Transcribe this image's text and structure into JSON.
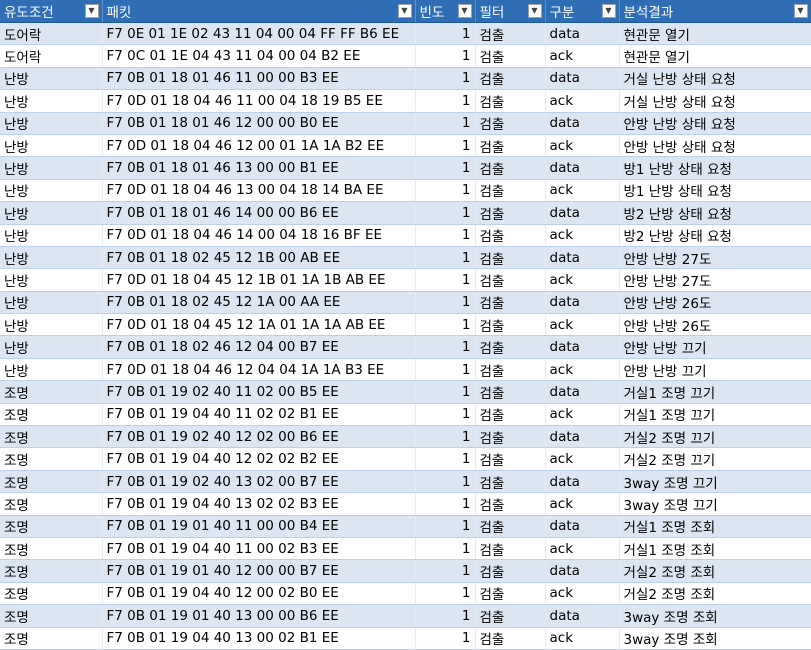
{
  "header": {
    "columns": [
      {
        "label": "유도조건",
        "filter_icon": "filter-active-icon"
      },
      {
        "label": "패킷",
        "filter_icon": "dropdown-arrow-icon"
      },
      {
        "label": "빈도",
        "filter_icon": "dropdown-arrow-icon"
      },
      {
        "label": "필터",
        "filter_icon": "dropdown-arrow-icon"
      },
      {
        "label": "구분",
        "filter_icon": "dropdown-arrow-icon"
      },
      {
        "label": "분석결과",
        "filter_icon": "dropdown-arrow-icon"
      }
    ]
  },
  "rows": [
    {
      "cond": "도어락",
      "packet": "F7 0E 01 1E 02 43 11 04 00 04 FF FF B6 EE",
      "freq": "1",
      "filter": "검출",
      "type": "data",
      "result": "현관문 열기"
    },
    {
      "cond": "도어락",
      "packet": "F7 0C 01 1E 04 43 11 04 00 04 B2 EE",
      "freq": "1",
      "filter": "검출",
      "type": "ack",
      "result": "현관문 열기"
    },
    {
      "cond": "난방",
      "packet": "F7 0B 01 18 01 46 11 00 00 B3 EE",
      "freq": "1",
      "filter": "검출",
      "type": "data",
      "result": "거실 난방 상태 요청"
    },
    {
      "cond": "난방",
      "packet": "F7 0D 01 18 04 46 11 00 04 18 19 B5 EE",
      "freq": "1",
      "filter": "검출",
      "type": "ack",
      "result": "거실 난방 상태 요청"
    },
    {
      "cond": "난방",
      "packet": "F7 0B 01 18 01 46 12 00 00 B0 EE",
      "freq": "1",
      "filter": "검출",
      "type": "data",
      "result": "안방 난방 상태 요청"
    },
    {
      "cond": "난방",
      "packet": "F7 0D 01 18 04 46 12 00 01 1A 1A B2 EE",
      "freq": "1",
      "filter": "검출",
      "type": "ack",
      "result": "안방 난방 상태 요청"
    },
    {
      "cond": "난방",
      "packet": "F7 0B 01 18 01 46 13 00 00 B1 EE",
      "freq": "1",
      "filter": "검출",
      "type": "data",
      "result": "방1 난방 상태 요청"
    },
    {
      "cond": "난방",
      "packet": "F7 0D 01 18 04 46 13 00 04 18 14 BA EE",
      "freq": "1",
      "filter": "검출",
      "type": "ack",
      "result": "방1 난방 상태 요청"
    },
    {
      "cond": "난방",
      "packet": "F7 0B 01 18 01 46 14 00 00 B6 EE",
      "freq": "1",
      "filter": "검출",
      "type": "data",
      "result": "방2 난방 상태 요청"
    },
    {
      "cond": "난방",
      "packet": "F7 0D 01 18 04 46 14 00 04 18 16 BF EE",
      "freq": "1",
      "filter": "검출",
      "type": "ack",
      "result": "방2 난방 상태 요청"
    },
    {
      "cond": "난방",
      "packet": "F7 0B 01 18 02 45 12 1B 00 AB EE",
      "freq": "1",
      "filter": "검출",
      "type": "data",
      "result": "안방 난방 27도"
    },
    {
      "cond": "난방",
      "packet": "F7 0D 01 18 04 45 12 1B 01 1A 1B AB EE",
      "freq": "1",
      "filter": "검출",
      "type": "ack",
      "result": "안방 난방 27도"
    },
    {
      "cond": "난방",
      "packet": "F7 0B 01 18 02 45 12 1A 00 AA EE",
      "freq": "1",
      "filter": "검출",
      "type": "data",
      "result": "안방 난방 26도"
    },
    {
      "cond": "난방",
      "packet": "F7 0D 01 18 04 45 12 1A 01 1A 1A AB EE",
      "freq": "1",
      "filter": "검출",
      "type": "ack",
      "result": "안방 난방 26도"
    },
    {
      "cond": "난방",
      "packet": "F7 0B 01 18 02 46 12 04 00 B7 EE",
      "freq": "1",
      "filter": "검출",
      "type": "data",
      "result": "안방 난방 끄기"
    },
    {
      "cond": "난방",
      "packet": "F7 0D 01 18 04 46 12 04 04 1A 1A B3 EE",
      "freq": "1",
      "filter": "검출",
      "type": "ack",
      "result": "안방 난방 끄기"
    },
    {
      "cond": "조명",
      "packet": "F7 0B 01 19 02 40 11 02 00 B5 EE",
      "freq": "1",
      "filter": "검출",
      "type": "data",
      "result": "거실1 조명 끄기"
    },
    {
      "cond": "조명",
      "packet": "F7 0B 01 19 04 40 11 02 02 B1 EE",
      "freq": "1",
      "filter": "검출",
      "type": "ack",
      "result": "거실1 조명 끄기"
    },
    {
      "cond": "조명",
      "packet": "F7 0B 01 19 02 40 12 02 00 B6 EE",
      "freq": "1",
      "filter": "검출",
      "type": "data",
      "result": "거실2 조명 끄기"
    },
    {
      "cond": "조명",
      "packet": "F7 0B 01 19 04 40 12 02 02 B2 EE",
      "freq": "1",
      "filter": "검출",
      "type": "ack",
      "result": "거실2 조명 끄기"
    },
    {
      "cond": "조명",
      "packet": "F7 0B 01 19 02 40 13 02 00 B7 EE",
      "freq": "1",
      "filter": "검출",
      "type": "data",
      "result": "3way 조명 끄기"
    },
    {
      "cond": "조명",
      "packet": "F7 0B 01 19 04 40 13 02 02 B3 EE",
      "freq": "1",
      "filter": "검출",
      "type": "ack",
      "result": "3way 조명 끄기"
    },
    {
      "cond": "조명",
      "packet": "F7 0B 01 19 01 40 11 00 00 B4 EE",
      "freq": "1",
      "filter": "검출",
      "type": "data",
      "result": "거실1 조명 조회"
    },
    {
      "cond": "조명",
      "packet": "F7 0B 01 19 04 40 11 00 02 B3 EE",
      "freq": "1",
      "filter": "검출",
      "type": "ack",
      "result": "거실1 조명 조회"
    },
    {
      "cond": "조명",
      "packet": "F7 0B 01 19 01 40 12 00 00 B7 EE",
      "freq": "1",
      "filter": "검출",
      "type": "data",
      "result": "거실2 조명 조회"
    },
    {
      "cond": "조명",
      "packet": "F7 0B 01 19 04 40 12 00 02 B0 EE",
      "freq": "1",
      "filter": "검출",
      "type": "ack",
      "result": "거실2 조명 조회"
    },
    {
      "cond": "조명",
      "packet": "F7 0B 01 19 01 40 13 00 00 B6 EE",
      "freq": "1",
      "filter": "검출",
      "type": "data",
      "result": "3way 조명 조회"
    },
    {
      "cond": "조명",
      "packet": "F7 0B 01 19 04 40 13 00 02 B1 EE",
      "freq": "1",
      "filter": "검출",
      "type": "ack",
      "result": "3way 조명 조회"
    }
  ],
  "colors": {
    "header_bg": "#2f6db5",
    "band_bg": "#dce6f2",
    "row_bg": "#ffffff"
  }
}
